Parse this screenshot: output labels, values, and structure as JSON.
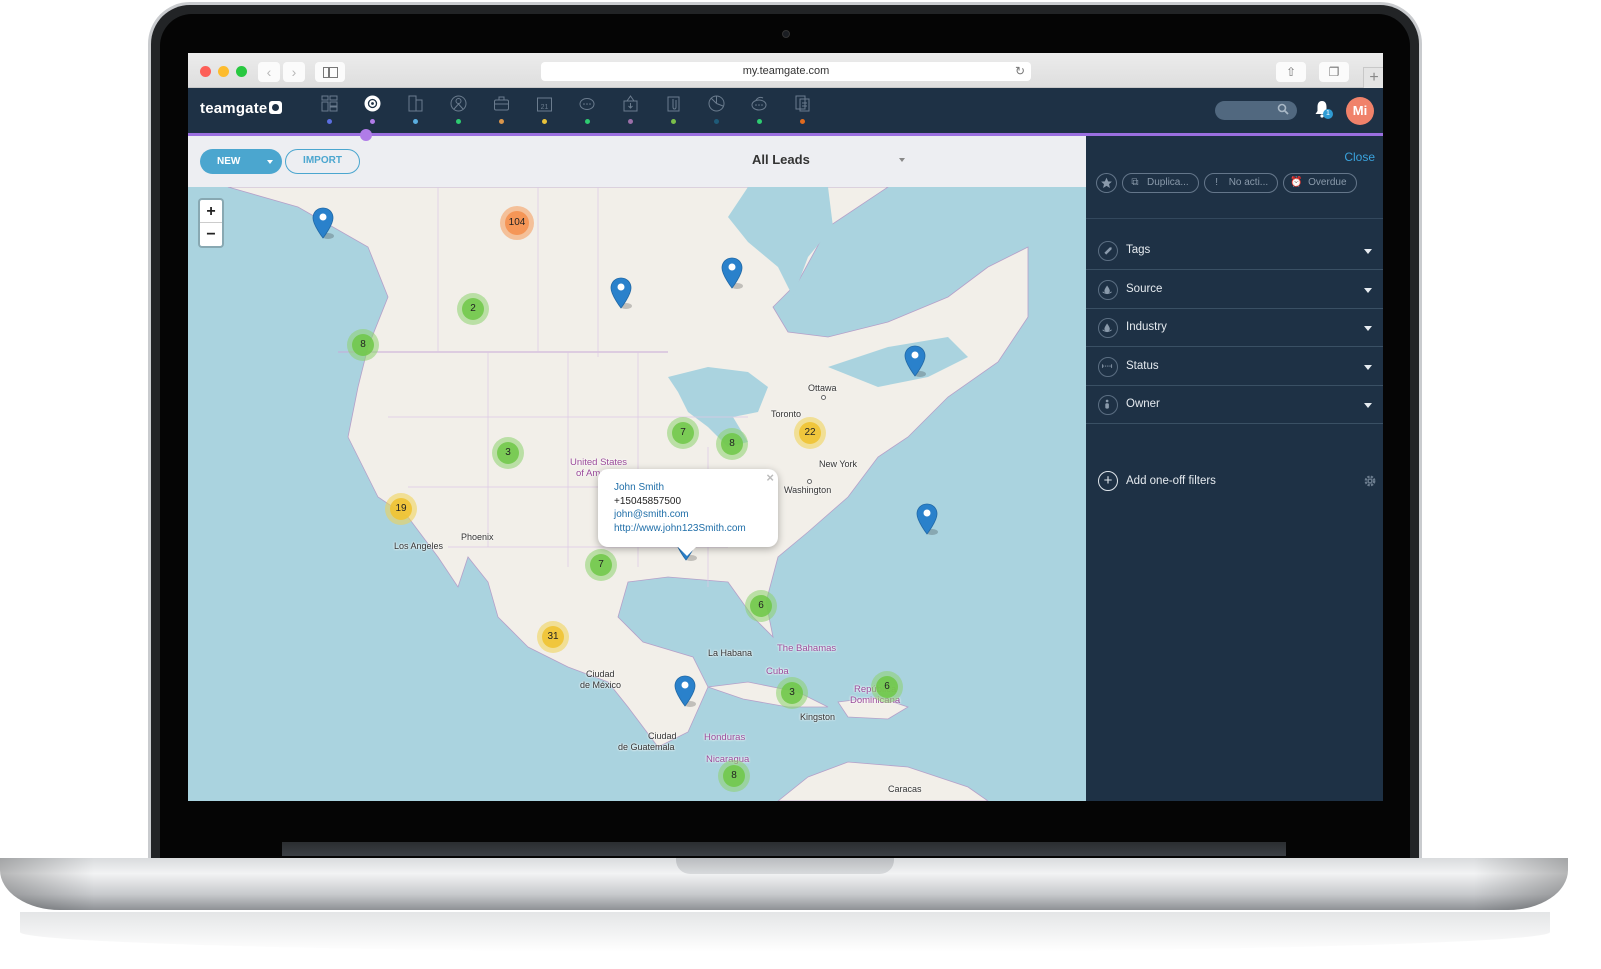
{
  "browser": {
    "url": "my.teamgate.com",
    "back_icon": "chevron-left-icon",
    "forward_icon": "chevron-right-icon",
    "new_tab_label": "+"
  },
  "app": {
    "logo_text": "teamgate",
    "nav_items": [
      {
        "name": "dashboard",
        "icon": "dashboard-icon",
        "dot_color": "#5b6ee0",
        "active": false
      },
      {
        "name": "leads",
        "icon": "target-icon",
        "dot_color": "#b07ce8",
        "active": true
      },
      {
        "name": "companies",
        "icon": "building-icon",
        "dot_color": "#5aaee0",
        "active": false
      },
      {
        "name": "contacts",
        "icon": "person-icon",
        "dot_color": "#2ecc71",
        "active": false
      },
      {
        "name": "deals",
        "icon": "briefcase-icon",
        "dot_color": "#d9954b",
        "active": false
      },
      {
        "name": "calendar",
        "icon": "calendar-icon",
        "dot_color": "#e8c23a",
        "active": false
      },
      {
        "name": "conversations",
        "icon": "chat-icon",
        "dot_color": "#2ecc71",
        "active": false
      },
      {
        "name": "inbox",
        "icon": "inbox-download-icon",
        "dot_color": "#9b6fa8",
        "active": false
      },
      {
        "name": "files",
        "icon": "paperclip-icon",
        "dot_color": "#7bbf4a",
        "active": false
      },
      {
        "name": "reports",
        "icon": "pie-chart-icon",
        "dot_color": "#1e5a78",
        "active": false
      },
      {
        "name": "messages",
        "icon": "chat-bubbles-icon",
        "dot_color": "#2ecc71",
        "active": false
      },
      {
        "name": "documents",
        "icon": "document-icon",
        "dot_color": "#e06a1e",
        "active": false
      }
    ],
    "calendar_day": "21",
    "notification_count": "1",
    "avatar_initials": "Mi",
    "accent_color": "#9b6fe0"
  },
  "toolbar": {
    "new_label": "NEW",
    "import_label": "IMPORT",
    "view_label": "All Leads"
  },
  "map": {
    "zoom_in_label": "+",
    "zoom_out_label": "−",
    "clusters": [
      {
        "count": "104",
        "size": "large"
      },
      {
        "count": "2",
        "size": "small"
      },
      {
        "count": "8",
        "size": "small"
      },
      {
        "count": "3",
        "size": "small"
      },
      {
        "count": "7",
        "size": "small"
      },
      {
        "count": "8",
        "size": "small"
      },
      {
        "count": "22",
        "size": "medium"
      },
      {
        "count": "19",
        "size": "medium"
      },
      {
        "count": "7",
        "size": "small"
      },
      {
        "count": "6",
        "size": "small"
      },
      {
        "count": "31",
        "size": "medium"
      },
      {
        "count": "3",
        "size": "small"
      },
      {
        "count": "6",
        "size": "small"
      },
      {
        "count": "8",
        "size": "small"
      }
    ],
    "labels": {
      "ottawa": "Ottawa",
      "toronto": "Toronto",
      "new_york": "New York",
      "washington": "Washington",
      "united_states_1": "United States",
      "united_states_2": "of America",
      "phoenix": "Phoenix",
      "los_angeles": "Los Angeles",
      "la_habana": "La Habana",
      "the_bahamas": "The Bahamas",
      "cuba": "Cuba",
      "ciudad_mexico_1": "Ciudad",
      "ciudad_mexico_2": "de México",
      "ciudad_guatemala_1": "Ciudad",
      "ciudad_guatemala_2": "de Guatemala",
      "honduras": "Honduras",
      "nicaragua": "Nicaragua",
      "kingston": "Kingston",
      "republica_1": "República",
      "republica_2": "Dominicana",
      "caracas": "Caracas"
    },
    "popup": {
      "name": "John Smith",
      "phone": "+15045857500",
      "email": "john@smith.com",
      "website": "http://www.john123Smith.com",
      "close_label": "×"
    }
  },
  "filters": {
    "close_label": "Close",
    "quick_chips": [
      {
        "label": "Duplica...",
        "icon": "duplicate-icon"
      },
      {
        "label": "No acti...",
        "icon": "exclamation-icon"
      },
      {
        "label": "Overdue",
        "icon": "alarm-clock-icon"
      }
    ],
    "rows": [
      {
        "label": "Tags",
        "icon": "tag-icon"
      },
      {
        "label": "Source",
        "icon": "droplet-icon"
      },
      {
        "label": "Industry",
        "icon": "droplet-icon"
      },
      {
        "label": "Status",
        "icon": "status-range-icon"
      },
      {
        "label": "Owner",
        "icon": "person-icon"
      }
    ],
    "add_filters_label": "Add one-off filters"
  }
}
